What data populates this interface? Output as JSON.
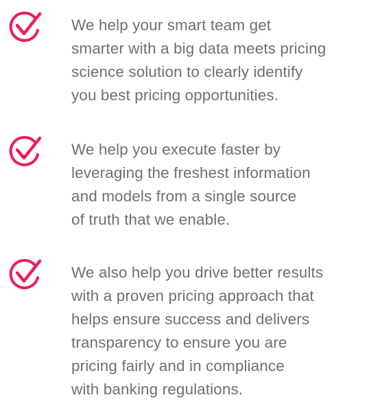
{
  "accent_color": "#ec1f5b",
  "text_color": "#6f6f6f",
  "features": [
    {
      "icon": "checkmark-circle-icon",
      "lines": [
        "We help your smart team get",
        "smarter with a big data meets pricing",
        "science solution to clearly identify",
        "you best pricing opportunities."
      ]
    },
    {
      "icon": "checkmark-circle-icon",
      "lines": [
        "We help you execute faster by",
        "leveraging the freshest information",
        "and models from a single source",
        "of truth that we enable."
      ]
    },
    {
      "icon": "checkmark-circle-icon",
      "lines": [
        "We also help you drive better results",
        "with a proven pricing approach that",
        "helps ensure success and delivers",
        "transparency to ensure you are",
        "pricing fairly and in compliance",
        "with banking regulations."
      ]
    }
  ]
}
